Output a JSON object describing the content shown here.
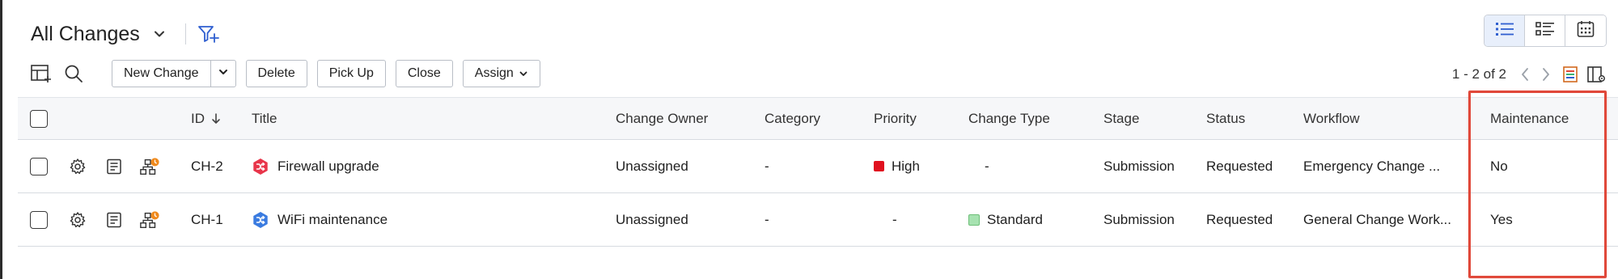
{
  "header": {
    "view_title": "All Changes"
  },
  "toolbar": {
    "new_change_label": "New Change",
    "delete_label": "Delete",
    "pickup_label": "Pick Up",
    "close_label": "Close",
    "assign_label": "Assign"
  },
  "pagination": {
    "range": "1 - 2 of 2"
  },
  "table": {
    "columns": {
      "id": "ID",
      "title": "Title",
      "owner": "Change Owner",
      "category": "Category",
      "priority": "Priority",
      "change_type": "Change Type",
      "stage": "Stage",
      "status": "Status",
      "workflow": "Workflow",
      "maintenance": "Maintenance"
    },
    "rows": [
      {
        "id": "CH-2",
        "title": "Firewall upgrade",
        "owner": "Unassigned",
        "category": "-",
        "priority": "High",
        "change_type": "-",
        "stage": "Submission",
        "status": "Requested",
        "workflow": "Emergency Change ...",
        "maintenance": "No"
      },
      {
        "id": "CH-1",
        "title": "WiFi maintenance",
        "owner": "Unassigned",
        "category": "-",
        "priority": "-",
        "change_type": "Standard",
        "stage": "Submission",
        "status": "Requested",
        "workflow": "General Change Work...",
        "maintenance": "Yes"
      }
    ]
  },
  "colors": {
    "accent": "#2f5fd0",
    "priority_high": "#e0101e",
    "standard_type": "#a6e2b0",
    "highlight": "#e0483a",
    "emergency_icon": "#e8354a",
    "general_icon": "#3a7be0"
  },
  "icons": [
    "chevron-down-icon",
    "filter-add-icon",
    "list-view-icon",
    "detail-list-view-icon",
    "calendar-view-icon",
    "table-settings-icon",
    "search-icon",
    "chevron-left-icon",
    "chevron-right-icon",
    "export-icon",
    "column-chooser-icon",
    "gear-icon",
    "notes-icon",
    "workflow-icon",
    "sort-down-icon",
    "change-type-icon"
  ]
}
